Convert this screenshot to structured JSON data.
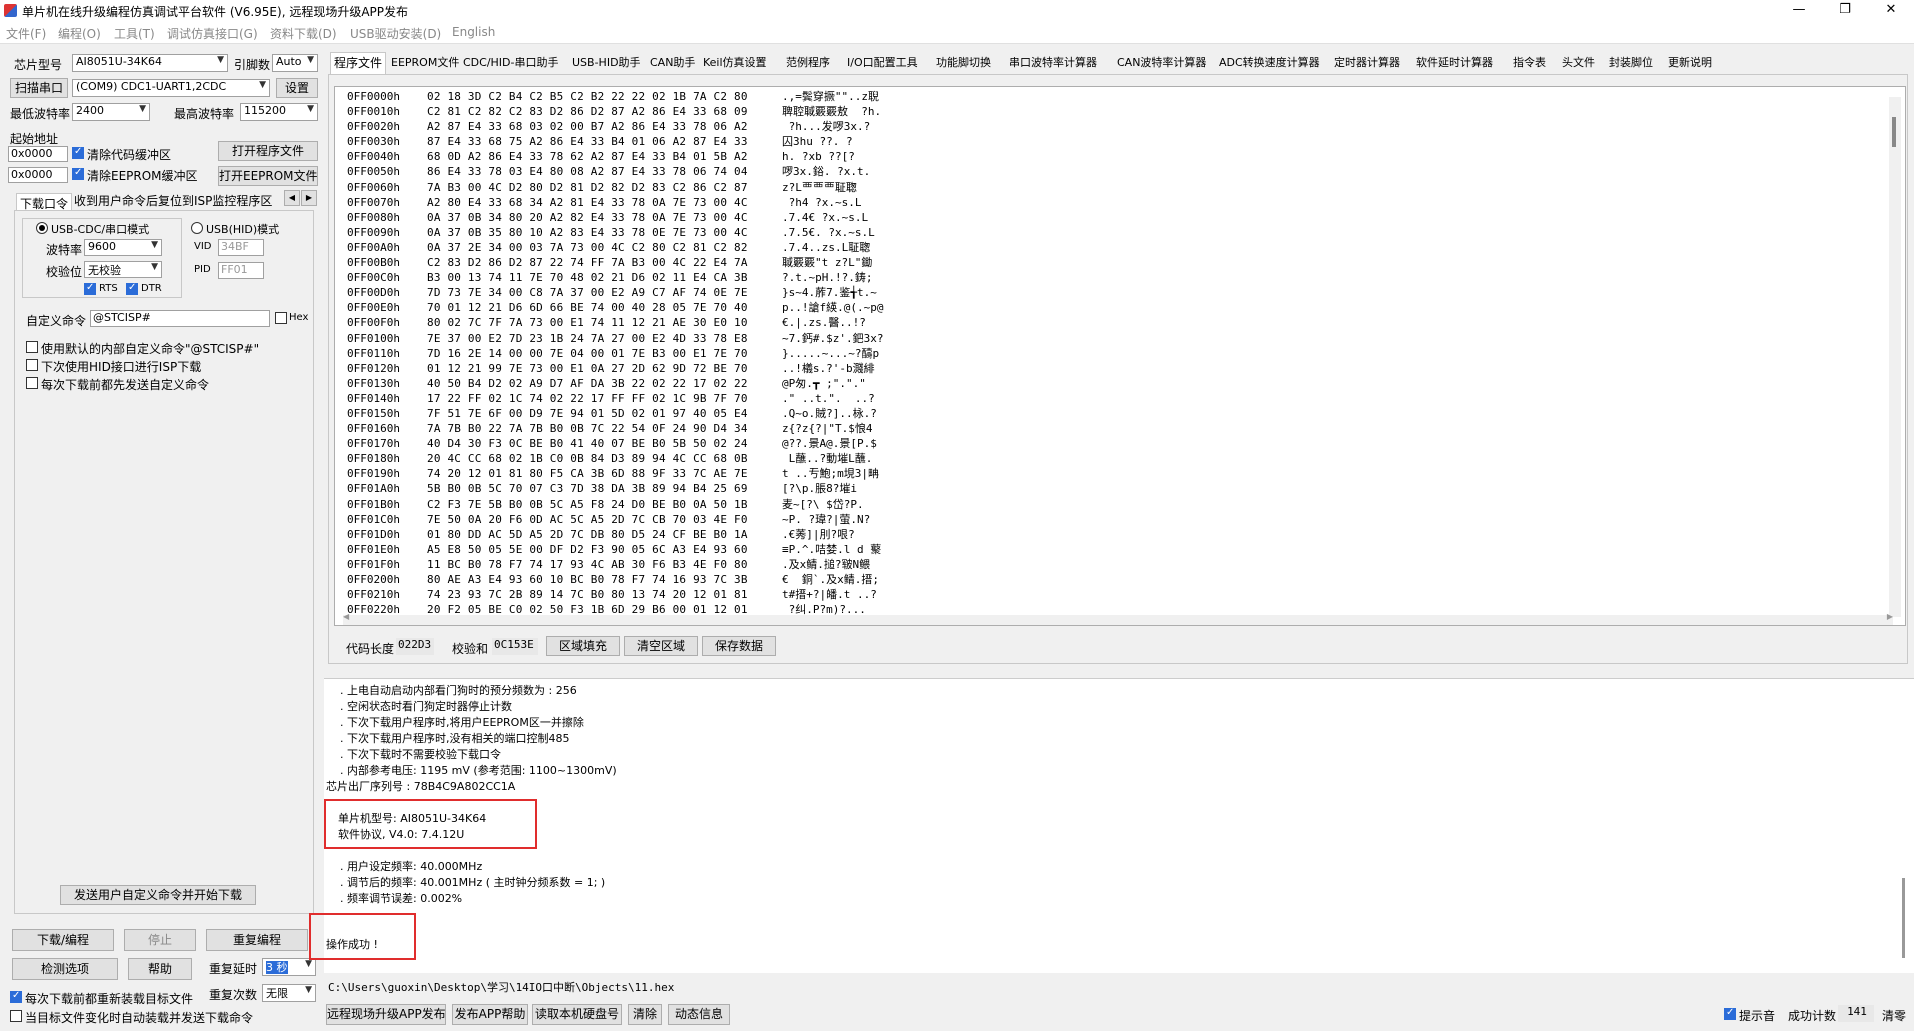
{
  "window": {
    "title": "单片机在线升级编程仿真调试平台软件 (V6.95E), 远程现场升级APP发布",
    "min": "—",
    "max": "❐",
    "close": "✕"
  },
  "menu": [
    "文件(F)",
    "编程(O)",
    "工具(T)",
    "调试仿真接口(G)",
    "资料下载(D)",
    "USB驱动安装(D)",
    "English"
  ],
  "left": {
    "chip_label": "芯片型号",
    "chip_value": "AI8051U-34K64",
    "pin_label": "引脚数",
    "pin_value": "Auto",
    "scan_label": "扫描串口",
    "port_value": "(COM9) CDC1-UART1,2CDC",
    "settings_button": "设置",
    "min_baud_label": "最低波特率",
    "min_baud_value": "2400",
    "max_baud_label": "最高波特率",
    "max_baud_value": "115200",
    "start_addr_label": "起始地址",
    "addr1": "0x0000",
    "clear_code_label": "清除代码缓冲区",
    "open_program_button": "打开程序文件",
    "addr2": "0x0000",
    "clear_eeprom_label": "清除EEPROM缓冲区",
    "open_eeprom_button": "打开EEPROM文件",
    "subtab1": "下载口令",
    "subtab2": "收到用户命令后复位到ISP监控程序区",
    "usb_cdc_mode": "USB-CDC/串口模式",
    "usb_hid_mode": "USB(HID)模式",
    "baud_label": "波特率",
    "baud_value": "9600",
    "parity_label": "校验位",
    "parity_value": "无校验",
    "vid_label": "VID",
    "vid_value": "34BF",
    "pid_label": "PID",
    "pid_value": "FF01",
    "rts_label": "RTS",
    "dtr_label": "DTR",
    "custom_cmd_label": "自定义命令",
    "custom_cmd_value": "@STCISP#",
    "hex_label": "Hex",
    "opt1": "使用默认的内部自定义命令\"@STCISP#\"",
    "opt2": "下次使用HID接口进行ISP下载",
    "opt3": "每次下载前都先发送自定义命令",
    "send_cmd_button": "发送用户自定义命令并开始下载",
    "download_button": "下载/编程",
    "stop_button": "停止",
    "reprogram_button": "重复编程",
    "check_button": "检测选项",
    "help_button": "帮助",
    "repeat_delay_label": "重复延时",
    "repeat_delay_value": "3 秒",
    "repeat_count_label": "重复次数",
    "repeat_count_value": "无限",
    "reload_label": "每次下载前都重新装载目标文件",
    "auto_reload_label": "当目标文件变化时自动装载并发送下载命令"
  },
  "tabs": [
    "程序文件",
    "EEPROM文件",
    "CDC/HID-串口助手",
    "USB-HID助手",
    "CAN助手",
    "Keil仿真设置",
    "范例程序",
    "I/O口配置工具",
    "功能脚切换",
    "串口波特率计算器",
    "CAN波特率计算器",
    "ADC转换速度计算器",
    "定时器计算器",
    "软件延时计算器",
    "指令表",
    "头文件",
    "封装脚位",
    "更新说明"
  ],
  "hex": {
    "rows": [
      [
        "0FF0000h",
        "02 18 3D C2 B4 C2 B5 C2 B2 22 22 02 1B 7A C2 80",
        ".,=鬓穿撅\"\"..z聣"
      ],
      [
        "0FF0010h",
        "C2 81 C2 82 C2 83 D2 86 D2 87 A2 86 E4 33 68 09",
        "聛聜聝覈覈敖  ?h."
      ],
      [
        "0FF0020h",
        "A2 87 E4 33 68 03 02 00 B7 A2 86 E4 33 78 06 A2",
        " ?h...发啰3x.?"
      ],
      [
        "0FF0030h",
        "87 E4 33 68 75 A2 86 E4 33 B4 01 06 A2 87 E4 33",
        "囚3hu ??. ?"
      ],
      [
        "0FF0040h",
        "68 0D A2 86 E4 33 78 62 A2 87 E4 33 B4 01 5B A2",
        "h. ?xb ??[?"
      ],
      [
        "0FF0050h",
        "86 E4 33 78 03 E4 80 08 A2 87 E4 33 78 06 74 04",
        "啰3x.鋊. ?x.t."
      ],
      [
        "0FF0060h",
        "7A B3 00 4C D2 80 D2 81 D2 82 D2 83 C2 86 C2 87",
        "z?L覀覀覀聇聦"
      ],
      [
        "0FF0070h",
        "A2 80 E4 33 68 34 A2 81 E4 33 78 0A 7E 73 00 4C",
        " ?h4 ?x.~s.L"
      ],
      [
        "0FF0080h",
        "0A 37 0B 34 80 20 A2 82 E4 33 78 0A 7E 73 00 4C",
        ".7.4€ ?x.~s.L"
      ],
      [
        "0FF0090h",
        "0A 37 0B 35 80 10 A2 83 E4 33 78 0E 7E 73 00 4C",
        ".7.5€. ?x.~s.L"
      ],
      [
        "0FF00A0h",
        "0A 37 2E 34 00 03 7A 73 00 4C C2 80 C2 81 C2 82",
        ".7.4..zs.L聇聦"
      ],
      [
        "0FF00B0h",
        "C2 83 D2 86 D2 87 22 74 FF 7A B3 00 4C 22 E4 7A",
        "聝覈覈\"t z?L\"鋤"
      ],
      [
        "0FF00C0h",
        "B3 00 13 74 11 7E 70 48 02 21 D6 02 11 E4 CA 3B",
        "?.t.~pH.!?.鋳;"
      ],
      [
        "0FF00D0h",
        "7D 73 7E 34 00 C8 7A 37 00 E2 A9 C7 AF 74 0E 7E",
        "}s~4.葄7.鉴╅t.~"
      ],
      [
        "0FF00E0h",
        "70 01 12 21 D6 6D 66 BE 74 00 40 28 05 7E 70 40",
        "p..!謒f緓.@(.~p@"
      ],
      [
        "0FF00F0h",
        "80 02 7C 7F 7A 73 00 E1 74 11 12 21 AE 30 E0 10",
        "€.|.zs.醫..!?"
      ],
      [
        "0FF0100h",
        "7E 37 00 E2 7D 23 1B 24 7A 27 00 E2 4D 33 78 E8",
        "~7.鈣#.$z'.鈀3x?"
      ],
      [
        "0FF0110h",
        "7D 16 2E 14 00 00 7E 04 00 01 7E B3 00 E1 7E 70",
        "}.....~...~?醻p"
      ],
      [
        "0FF0120h",
        "01 12 21 99 7E 73 00 E1 0A 27 2D 62 9D 72 BE 70",
        "..!檥s.?'-b濺緋"
      ],
      [
        "0FF0130h",
        "40 50 B4 D2 02 A9 D7 AF DA 3B 22 02 22 17 02 22",
        "@P匆.┳ ;\".\".\""
      ],
      [
        "0FF0140h",
        "17 22 FF 02 1C 74 02 22 17 FF FF 02 1C 9B 7F 70",
        ".\" ..t.\".  ..?"
      ],
      [
        "0FF0150h",
        "7F 51 7E 6F 00 D9 7E 94 01 5D 02 01 97 40 05 E4",
        ".Q~o.賊?]..栐.?"
      ],
      [
        "0FF0160h",
        "7A 7B B0 22 7A 7B B0 0B 7C 22 54 0F 24 90 D4 34",
        "z{?z{?|\"T.$悢4"
      ],
      [
        "0FF0170h",
        "40 D4 30 F3 0C BE B0 41 40 07 BE B0 5B 50 02 24",
        "@??.景A@.景[P.$"
      ],
      [
        "0FF0180h",
        "20 4C CC 68 02 1B C0 0B 84 D3 89 94 4C CC 68 0B",
        " L蘸..?動墔L蘸."
      ],
      [
        "0FF0190h",
        "74 20 12 01 81 80 F5 CA 3B 6D 88 9F 33 7C AE 7E",
        "t ..亐鮑;m垷3|畘"
      ],
      [
        "0FF01A0h",
        "5B B0 0B 5C 70 07 C3 7D 38 DA 3B 89 94 B4 25 69",
        "[?\\p.脹8?墔i"
      ],
      [
        "0FF01B0h",
        "C2 F3 7E 5B B0 0B 5C A5 F8 24 D0 BE B0 0A 50 1B",
        "麦~[?\\ $岱?P."
      ],
      [
        "0FF01C0h",
        "7E 50 0A 20 F6 0D AC 5C A5 2D 7C CB 70 03 4E F0",
        "~P. ?瑋?|萤.N?"
      ],
      [
        "0FF01D0h",
        "01 80 DD AC 5D A5 2D 7C DB 80 D5 24 CF BE B0 1A",
        ".€莠]|刖?哏?"
      ],
      [
        "0FF01E0h",
        "A5 E8 50 05 5E 00 DF D2 F3 90 05 6C A3 E4 93 60",
        "≡P.^.咭婪.l d 藂"
      ],
      [
        "0FF01F0h",
        "11 BC B0 78 F7 74 17 93 4C AB 30 F6 B3 4E F0 80",
        ".及x鲭.搥?皲N鳂"
      ],
      [
        "0FF0200h",
        "80 AE A3 E4 93 60 10 BC B0 78 F7 74 16 93 7C 3B",
        "€  銅`.及x鲭.搢;"
      ],
      [
        "0FF0210h",
        "74 23 93 7C 2B 89 14 7C B0 80 13 74 20 12 01 81",
        "t#搢+?|皤.t ..?"
      ],
      [
        "0FF0220h",
        "20 F2 05 BE C0 02 50 F3 1B 6D 29 B6 00 01 12 01",
        " ?纠.P?m)?..."
      ]
    ]
  },
  "code_info": {
    "length_label": "代码长度",
    "length_value": "022D3",
    "checksum_label": "校验和",
    "checksum_value": "0C153E",
    "fill_button": "区域填充",
    "clear_button": "清空区域",
    "save_button": "保存数据"
  },
  "log": {
    "lines": [
      ". 上电自动启动内部看门狗时的预分频数为 : 256",
      ". 空闲状态时看门狗定时器停止计数",
      ". 下次下载用户程序时,将用户EEPROM区一并擦除",
      ". 下次下载用户程序时,没有相关的端口控制485",
      ". 下次下载时不需要校验下载口令",
      ". 内部参考电压: 1195 mV (参考范围: 1100~1300mV)",
      "芯片出厂序列号 : 78B4C9A802CC1A"
    ],
    "model_line": "单片机型号: AI8051U-34K64",
    "protocol_line": "软件协议, V4.0: 7.4.12U",
    "freq_lines": [
      ". 用户设定频率: 40.000MHz",
      ". 调节后的频率: 40.001MHz ( 主时钟分频系数 = 1; )",
      ". 频率调节误差: 0.002%"
    ],
    "success": "操作成功 !"
  },
  "file_path": "C:\\Users\\guoxin\\Desktop\\学习\\14IO口中断\\Objects\\11.hex",
  "status": {
    "remote_button": "远程现场升级APP发布",
    "publish_help_button": "发布APP帮助",
    "read_disk_button": "读取本机硬盘号",
    "clear_button": "清除",
    "dynamic_button": "动态信息",
    "sound_label": "提示音",
    "success_count_label": "成功计数",
    "success_count_value": "141",
    "clear_zero_button": "清零"
  }
}
